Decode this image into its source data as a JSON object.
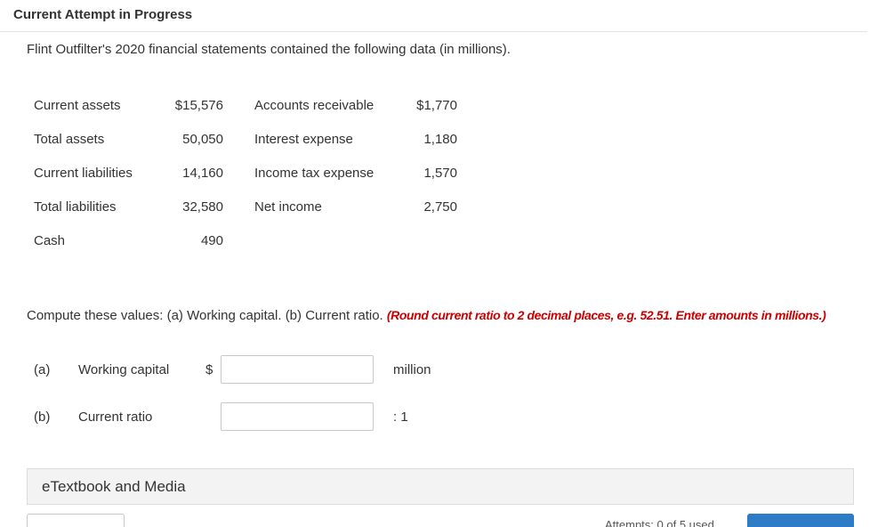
{
  "header": {
    "title": "Current Attempt in Progress"
  },
  "intro": "Flint Outfilter's 2020 financial statements contained the following data (in millions).",
  "table": {
    "rows": [
      {
        "label1": "Current assets",
        "value1": "$15,576",
        "label2": "Accounts receivable",
        "value2": "$1,770"
      },
      {
        "label1": "Total assets",
        "value1": "50,050",
        "label2": "Interest expense",
        "value2": "1,180"
      },
      {
        "label1": "Current liabilities",
        "value1": "14,160",
        "label2": "Income tax expense",
        "value2": "1,570"
      },
      {
        "label1": "Total liabilities",
        "value1": "32,580",
        "label2": "Net income",
        "value2": "2,750"
      },
      {
        "label1": "Cash",
        "value1": "490",
        "label2": "",
        "value2": ""
      }
    ]
  },
  "instruction": {
    "text": "Compute these values: (a) Working capital. (b) Current ratio. ",
    "note": "(Round current ratio to 2 decimal places, e.g. 52.51. Enter amounts in millions.)"
  },
  "answers": {
    "a": {
      "letter": "(a)",
      "label": "Working capital",
      "prefix": "$",
      "value": "",
      "suffix": "million"
    },
    "b": {
      "letter": "(b)",
      "label": "Current ratio",
      "value": "",
      "suffix": ": 1"
    }
  },
  "etextbook": {
    "label": "eTextbook and Media"
  },
  "footer": {
    "attempts_text": "Attempts: 0 of 5 used"
  },
  "colors": {
    "note": "#cc0000",
    "submit_button": "#2e7bc6",
    "etext_bg": "#f3f3f3"
  }
}
